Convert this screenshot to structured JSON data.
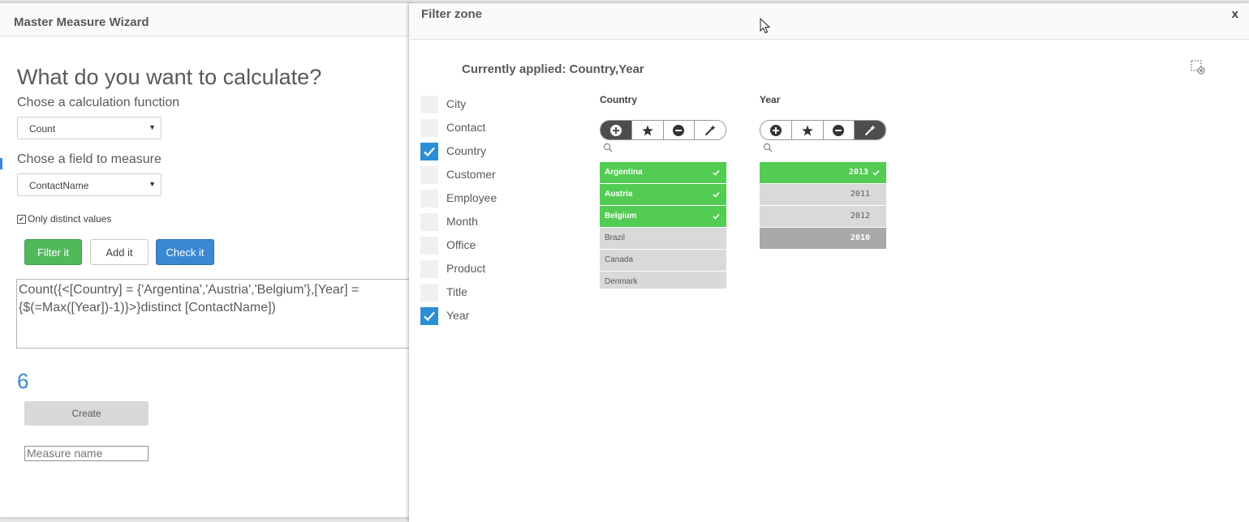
{
  "wizard": {
    "title": "Master Measure Wizard",
    "question": "What do you want to calculate?",
    "function_label": "Chose a calculation function",
    "function_value": "Count",
    "field_label": "Chose a field to measure",
    "field_value": "ContactName",
    "distinct_label": "Only distinct values",
    "buttons": {
      "filter": "Filter it",
      "add": "Add it",
      "check": "Check it"
    },
    "expression_line1": "Count({<[Country] = {'Argentina','Austria','Belgium'},[Year] =",
    "expression_line2": "{$(=Max([Year])-1)}>}distinct [ContactName])",
    "result": "6",
    "create_label": "Create",
    "measure_name_placeholder": "Measure name"
  },
  "filter_zone": {
    "title": "Filter zone",
    "close": "x",
    "applied": "Currently applied: Country,Year",
    "fields": [
      {
        "name": "City",
        "checked": false
      },
      {
        "name": "Contact",
        "checked": false
      },
      {
        "name": "Country",
        "checked": true
      },
      {
        "name": "Customer",
        "checked": false
      },
      {
        "name": "Employee",
        "checked": false
      },
      {
        "name": "Month",
        "checked": false
      },
      {
        "name": "Office",
        "checked": false
      },
      {
        "name": "Product",
        "checked": false
      },
      {
        "name": "Title",
        "checked": false
      },
      {
        "name": "Year",
        "checked": true
      }
    ],
    "country": {
      "title": "Country",
      "items": [
        {
          "label": "Argentina",
          "state": "selected"
        },
        {
          "label": "Austria",
          "state": "selected"
        },
        {
          "label": "Belgium",
          "state": "selected"
        },
        {
          "label": "Brazil",
          "state": "alternative"
        },
        {
          "label": "Canada",
          "state": "alternative"
        },
        {
          "label": "Denmark",
          "state": "alternative"
        }
      ]
    },
    "year": {
      "title": "Year",
      "items": [
        {
          "label": "2013",
          "state": "selected"
        },
        {
          "label": "2011",
          "state": "alternative"
        },
        {
          "label": "2012",
          "state": "alternative"
        },
        {
          "label": "2010",
          "state": "excluded"
        }
      ]
    }
  },
  "colors": {
    "selected": "#52cc52",
    "alternative": "#d9d9d9",
    "excluded": "#a9a9a9",
    "checkbox": "#2c8ed6",
    "accent": "#3a88d3"
  }
}
